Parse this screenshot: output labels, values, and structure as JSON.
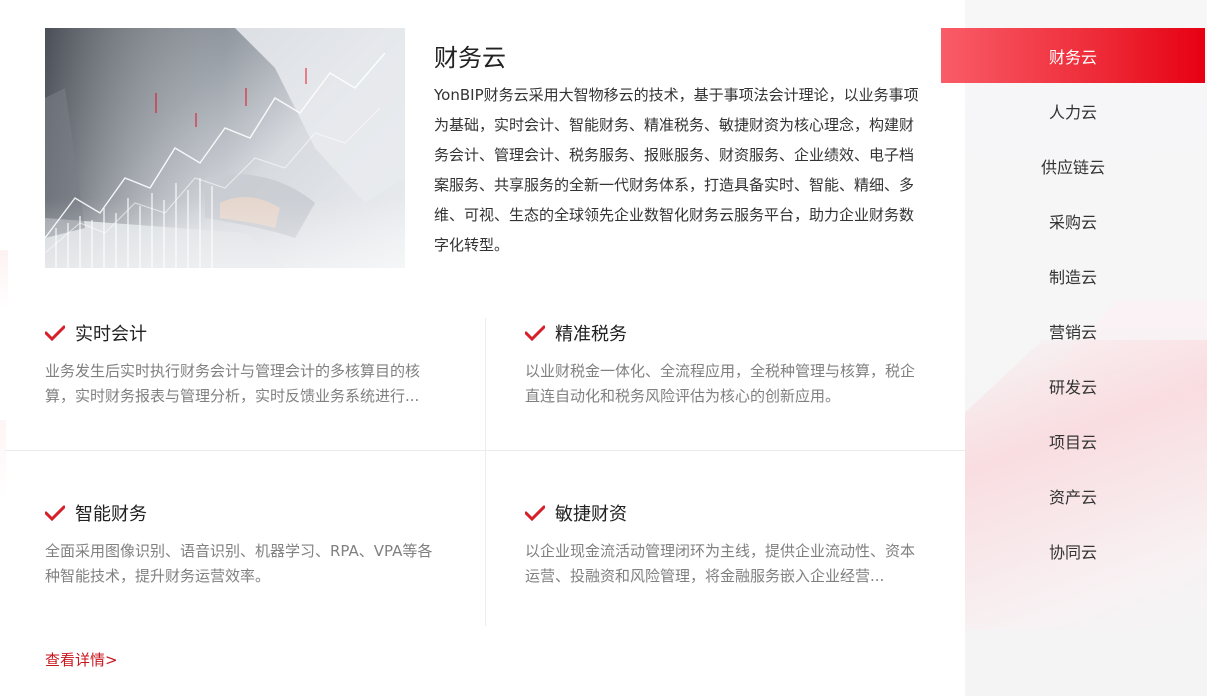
{
  "header": {
    "title": "财务云",
    "description": "YonBIP财务云采用大智物移云的技术，基于事项法会计理论，以业务事项为基础，实时会计、智能财务、精准税务、敏捷财资为核心理念，构建财务会计、管理会计、税务服务、报账服务、财资服务、企业绩效、电子档案服务、共享服务的全新一代财务体系，打造具备实时、智能、精细、多维、可视、生态的全球领先企业数智化财务云服务平台，助力企业财务数字化转型。"
  },
  "features": [
    {
      "title": "实时会计",
      "text": "业务发生后实时执行财务会计与管理会计的多核算目的核算，实时财务报表与管理分析，实时反馈业务系统进行..."
    },
    {
      "title": "精准税务",
      "text": "以业财税金一体化、全流程应用，全税种管理与核算，税企直连自动化和税务风险评估为核心的创新应用。"
    },
    {
      "title": "智能财务",
      "text": "全面采用图像识别、语音识别、机器学习、RPA、VPA等各种智能技术，提升财务运营效率。"
    },
    {
      "title": "敏捷财资",
      "text": "以企业现金流活动管理闭环为主线，提供企业流动性、资本运营、投融资和风险管理，将金融服务嵌入企业经营..."
    }
  ],
  "more_link": "查看详情>",
  "sidebar": {
    "items": [
      {
        "label": "财务云",
        "active": true
      },
      {
        "label": "人力云"
      },
      {
        "label": "供应链云"
      },
      {
        "label": "采购云"
      },
      {
        "label": "制造云"
      },
      {
        "label": "营销云"
      },
      {
        "label": "研发云"
      },
      {
        "label": "项目云"
      },
      {
        "label": "资产云"
      },
      {
        "label": "协同云"
      }
    ]
  },
  "colors": {
    "accent": "#e60012",
    "accent_light": "#f95c68",
    "link": "#c8161d",
    "check": "#d81e28",
    "muted_text": "#808080"
  },
  "icons": {
    "feature_marker": "checkmark-icon"
  }
}
